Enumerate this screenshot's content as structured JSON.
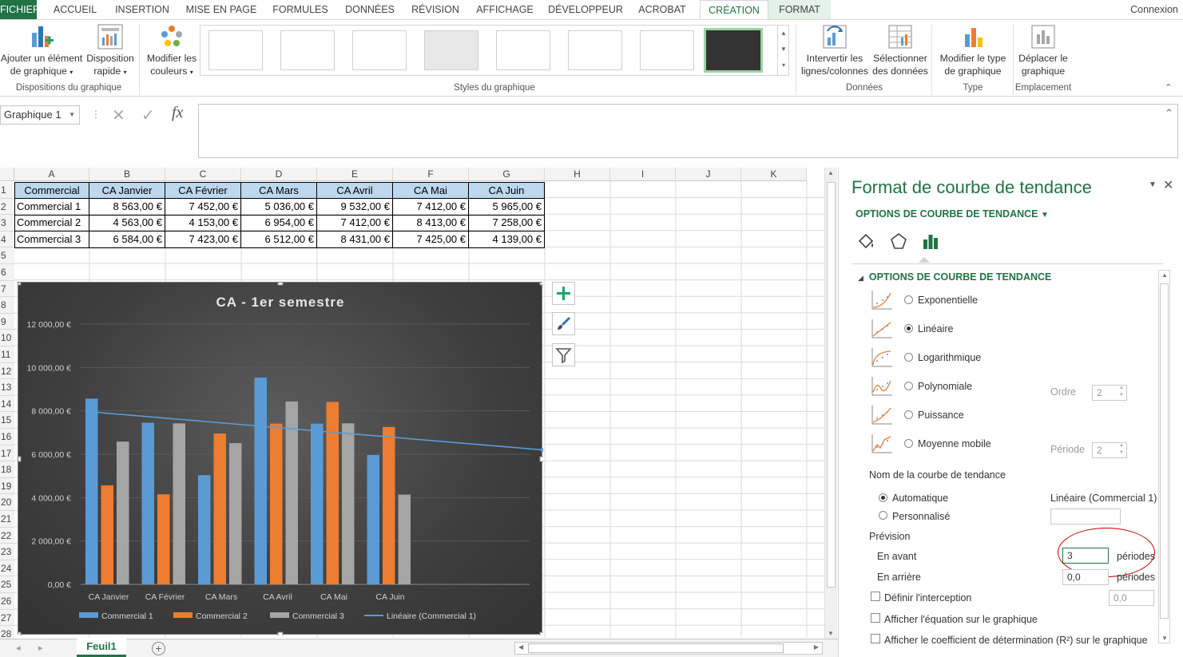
{
  "tabs": {
    "file": "FICHIER",
    "accueil": "ACCUEIL",
    "insertion": "INSERTION",
    "mise_en_page": "MISE EN PAGE",
    "formules": "FORMULES",
    "donnees": "DONNÉES",
    "revision": "RÉVISION",
    "affichage": "AFFICHAGE",
    "developpeur": "DÉVELOPPEUR",
    "acrobat": "ACROBAT",
    "creation": "CRÉATION",
    "format": "FORMAT",
    "connexion": "Connexion"
  },
  "ribbon": {
    "add_element_l1": "Ajouter un élément",
    "add_element_l2": "de graphique",
    "quick_layout_l1": "Disposition",
    "quick_layout_l2": "rapide",
    "group_layouts": "Dispositions du graphique",
    "change_colors_l1": "Modifier les",
    "change_colors_l2": "couleurs",
    "group_styles": "Styles du graphique",
    "switch_l1": "Intervertir les",
    "switch_l2": "lignes/colonnes",
    "select_l1": "Sélectionner",
    "select_l2": "des données",
    "group_data": "Données",
    "change_type_l1": "Modifier le type",
    "change_type_l2": "de graphique",
    "group_type": "Type",
    "move_l1": "Déplacer le",
    "move_l2": "graphique",
    "group_location": "Emplacement"
  },
  "formula_bar": {
    "name_box": "Graphique 1",
    "fx": "fx",
    "content": ""
  },
  "sheet": {
    "columns": [
      "A",
      "B",
      "C",
      "D",
      "E",
      "F",
      "G",
      "H",
      "I",
      "J",
      "K"
    ],
    "rows": [
      "1",
      "2",
      "3",
      "4",
      "5",
      "6",
      "7",
      "8",
      "9",
      "10",
      "11",
      "12",
      "13",
      "14",
      "15",
      "16",
      "17",
      "18",
      "19",
      "20",
      "21",
      "22",
      "23",
      "24",
      "25",
      "26",
      "27",
      "28"
    ],
    "header": [
      "Commercial",
      "CA Janvier",
      "CA Février",
      "CA Mars",
      "CA Avril",
      "CA Mai",
      "CA Juin"
    ],
    "data": [
      [
        "Commercial 1",
        "8 563,00 €",
        "7 452,00 €",
        "5 036,00 €",
        "9 532,00 €",
        "7 412,00 €",
        "5 965,00 €"
      ],
      [
        "Commercial 2",
        "4 563,00 €",
        "4 153,00 €",
        "6 954,00 €",
        "7 412,00 €",
        "8 413,00 €",
        "7 258,00 €"
      ],
      [
        "Commercial 3",
        "6 584,00 €",
        "7 423,00 €",
        "6 512,00 €",
        "8 431,00 €",
        "7 425,00 €",
        "4 139,00 €"
      ]
    ],
    "sheet_tab": "Feuil1"
  },
  "chart_data": {
    "type": "bar",
    "title": "CA - 1er semestre",
    "categories": [
      "CA Janvier",
      "CA Février",
      "CA Mars",
      "CA Avril",
      "CA Mai",
      "CA Juin"
    ],
    "series": [
      {
        "name": "Commercial 1",
        "color": "#5b9bd5",
        "values": [
          8563,
          7452,
          5036,
          9532,
          7412,
          5965
        ]
      },
      {
        "name": "Commercial 2",
        "color": "#ed7d31",
        "values": [
          4563,
          4153,
          6954,
          7412,
          8413,
          7258
        ]
      },
      {
        "name": "Commercial 3",
        "color": "#a5a5a5",
        "values": [
          6584,
          7423,
          6512,
          8431,
          7425,
          4139
        ]
      }
    ],
    "trendline": {
      "name": "Linéaire (Commercial 1)",
      "color": "#5b9bd5",
      "start": 7950,
      "end": 6200,
      "forward_periods": 3
    },
    "ylim": [
      0,
      12000
    ],
    "yticks": [
      "0,00 €",
      "2 000,00 €",
      "4 000,00 €",
      "6 000,00 €",
      "8 000,00 €",
      "10 000,00 €",
      "12 000,00 €"
    ],
    "grid": true,
    "legend": "bottom"
  },
  "pane": {
    "title": "Format de courbe de tendance",
    "subtitle": "OPTIONS DE COURBE DE TENDANCE",
    "section": "OPTIONS DE COURBE DE TENDANCE",
    "types": [
      "Exponentielle",
      "Linéaire",
      "Logarithmique",
      "Polynomiale",
      "Puissance",
      "Moyenne mobile"
    ],
    "order_label": "Ordre",
    "order_value": "2",
    "period_label": "Période",
    "period_value": "2",
    "name_label": "Nom de la courbe de tendance",
    "auto_label": "Automatique",
    "auto_value": "Linéaire (Commercial 1)",
    "custom_label": "Personnalisé",
    "forecast_label": "Prévision",
    "forward_label": "En avant",
    "forward_value": "3",
    "forward_unit": "périodes",
    "backward_label": "En arrière",
    "backward_value": "0,0",
    "backward_unit": "périodes",
    "intercept_label": "Définir l'interception",
    "intercept_value": "0,0",
    "equation_label": "Afficher l'équation sur le graphique",
    "r2_label": "Afficher le coefficient de détermination (R²) sur le graphique"
  }
}
